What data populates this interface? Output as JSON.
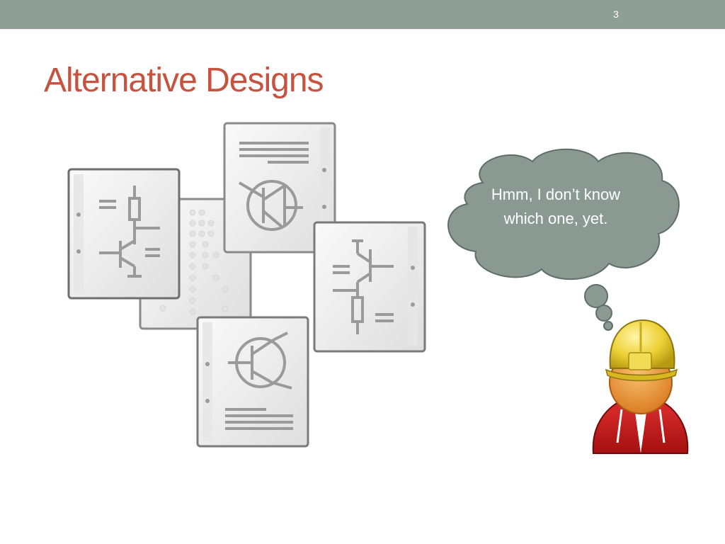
{
  "slide": {
    "number": "3",
    "title": "Alternative Designs",
    "thought_bubble_text": "Hmm, I don’t know which one, yet."
  },
  "colors": {
    "top_bar": "#8f9f98",
    "title": "#c5533f",
    "bubble_fill": "#8a9a93",
    "bubble_stroke": "#5f6e68",
    "helmet": "#e8c92a",
    "shirt": "#c41a1a",
    "face": "#e48a2a"
  },
  "icons": [
    "schematic-document-icon",
    "braille-document-icon",
    "transistor-document-icon",
    "engineer-with-hard-hat-icon",
    "thought-bubble-icon"
  ]
}
